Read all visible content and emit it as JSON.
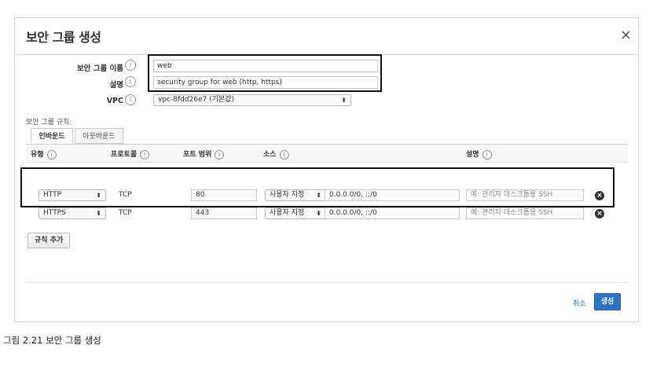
{
  "dialog": {
    "title": "보안 그룹 생성",
    "close_icon": "×"
  },
  "form": {
    "name_label": "보안 그룹 이름",
    "name_value": "web",
    "desc_label": "설명",
    "desc_value": "security group for web (http, https)",
    "vpc_label": "VPC",
    "vpc_value": "vpc-8fdd26e7 (기본값)",
    "info_glyph": "i"
  },
  "rules": {
    "section_label": "보안 그룹 규칙:",
    "tabs": [
      {
        "label": "인바운드",
        "active": true
      },
      {
        "label": "아웃바운드",
        "active": false
      }
    ],
    "headers": {
      "type": "유형",
      "protocol": "프로토콜",
      "port_range": "포트 범위",
      "source": "소스",
      "description": "설명"
    },
    "rows": [
      {
        "type": "HTTP",
        "protocol": "TCP",
        "port": "80",
        "source_type": "사용자 지정",
        "source_value": "0.0.0.0/0, ::/0",
        "desc_placeholder": "예: 관리자 데스크톱용 SSH"
      },
      {
        "type": "HTTPS",
        "protocol": "TCP",
        "port": "443",
        "source_type": "사용자 지정",
        "source_value": "0.0.0.0/0, ::/0",
        "desc_placeholder": "예: 관리자 데스크톱용 SSH"
      }
    ],
    "add_rule_label": "규칙 추가"
  },
  "footer": {
    "cancel_label": "취소",
    "create_label": "생성"
  },
  "caption": "그림 2.21 보안 그룹 생성",
  "colors": {
    "primary_button": "#2c73c4",
    "link": "#1a6fb5",
    "highlight_border": "#111111"
  }
}
